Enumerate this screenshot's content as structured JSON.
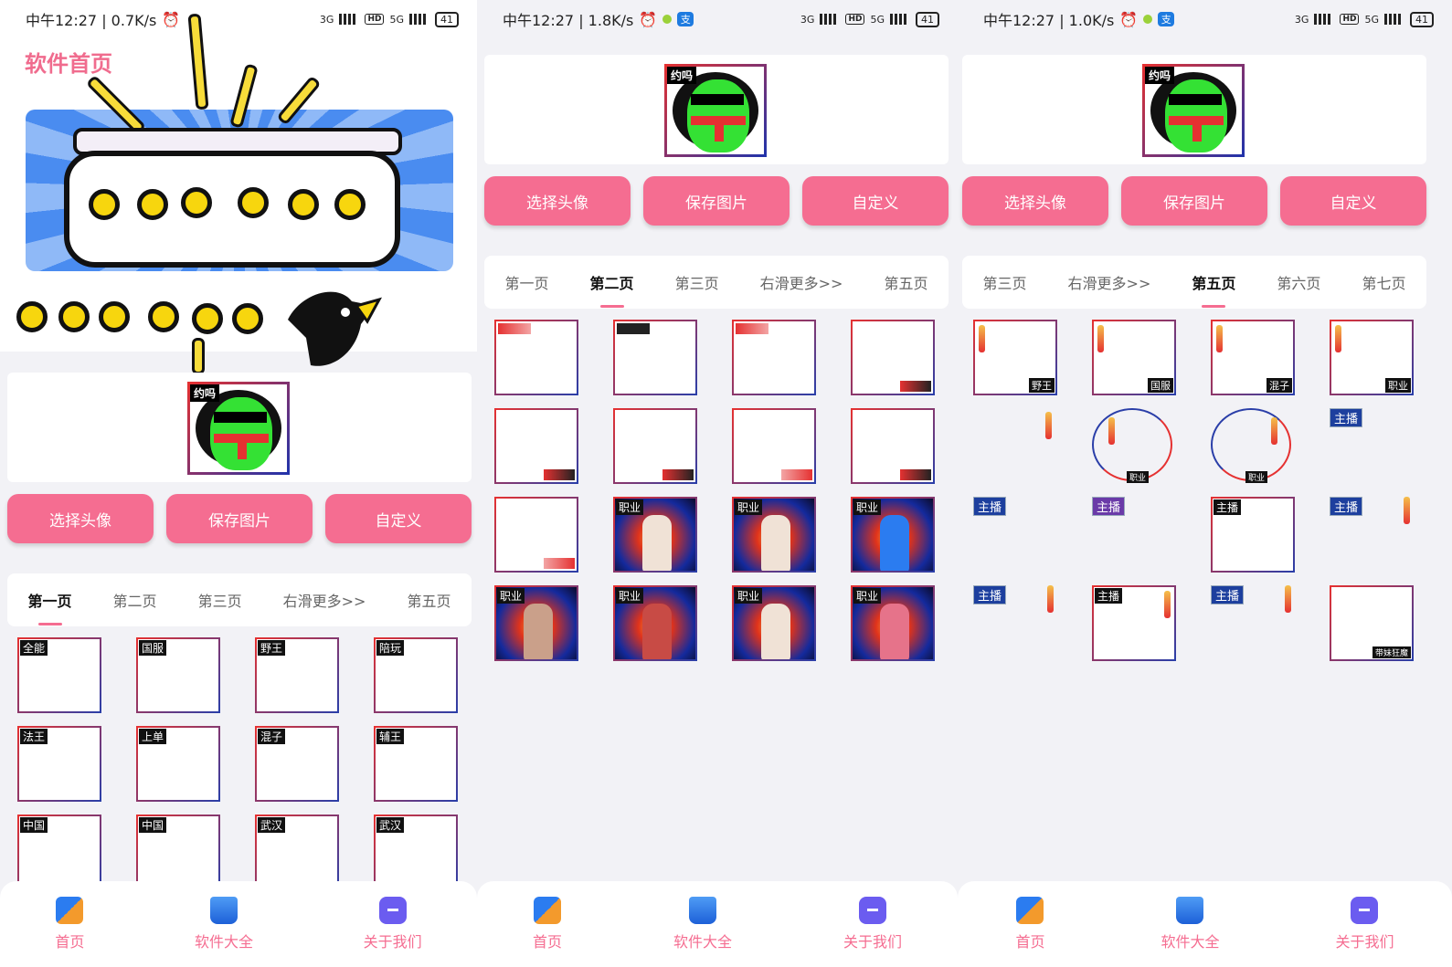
{
  "panels": [
    {
      "status": {
        "time": "中午12:27 | 0.7K/s",
        "battery": "41"
      },
      "title": "软件首页",
      "avatar_tag": "约吗",
      "buttons": [
        "选择头像",
        "保存图片",
        "自定义"
      ],
      "tabs": [
        "第一页",
        "第二页",
        "第三页",
        "右滑更多>>",
        "第五页"
      ],
      "active_tab": 0,
      "frames": [
        "全能",
        "国服",
        "野王",
        "陪玩",
        "法王",
        "上单",
        "混子",
        "辅王",
        "中国",
        "中国",
        "武汉",
        "武汉"
      ]
    },
    {
      "status": {
        "time": "中午12:27 | 1.8K/s",
        "battery": "41"
      },
      "avatar_tag": "约吗",
      "buttons": [
        "选择头像",
        "保存图片",
        "自定义"
      ],
      "tabs": [
        "第一页",
        "第二页",
        "第三页",
        "右滑更多>>",
        "第五页"
      ],
      "active_tab": 1,
      "photo_tags": [
        "职业",
        "职业",
        "职业",
        "职业",
        "职业",
        "职业",
        "职业"
      ]
    },
    {
      "status": {
        "time": "中午12:27 | 1.0K/s",
        "battery": "41"
      },
      "avatar_tag": "约吗",
      "buttons": [
        "选择头像",
        "保存图片",
        "自定义"
      ],
      "tabs": [
        "第三页",
        "右滑更多>>",
        "第五页",
        "第六页",
        "第七页"
      ],
      "active_tab": 2,
      "frames_row1": [
        "野王",
        "国服",
        "混子",
        "职业"
      ],
      "ring_tag": "职业",
      "host_tag": "主播",
      "last_frame_tag": "带妹狂魔"
    }
  ],
  "nav": [
    "首页",
    "软件大全",
    "关于我们"
  ],
  "status_icons": {
    "hd": "HD",
    "net1": "3G",
    "net2": "5G",
    "app": "支"
  },
  "colors": {
    "accent": "#f56d91",
    "frame_red": "#e53131",
    "frame_blue": "#2a3ea8"
  }
}
